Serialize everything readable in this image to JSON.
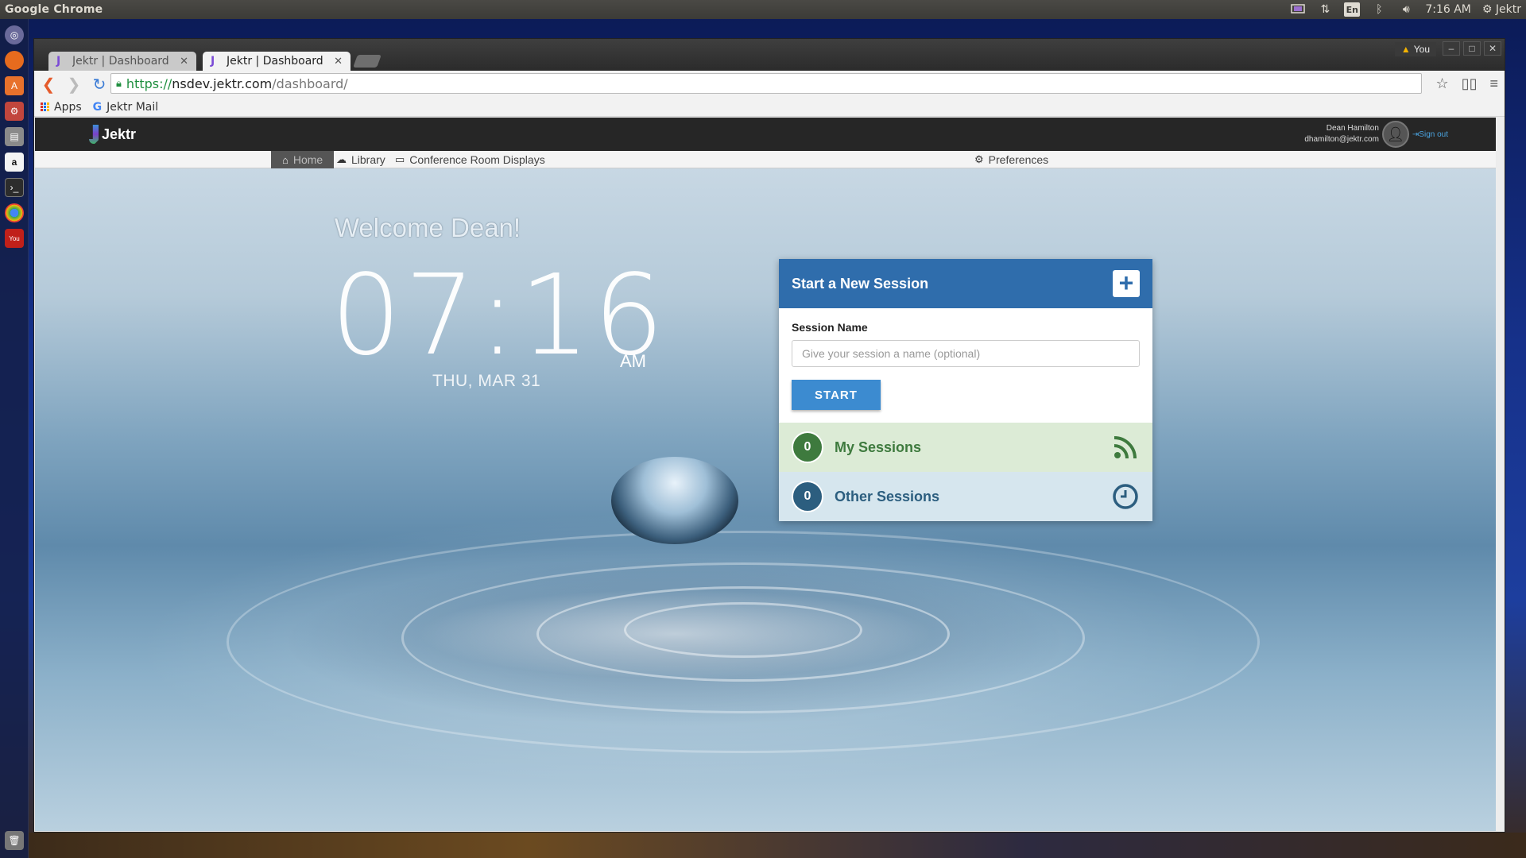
{
  "os_panel": {
    "app_title": "Google Chrome",
    "language": "En",
    "time": "7:16 AM",
    "user": "Jektr"
  },
  "browser": {
    "tabs": [
      {
        "label": "Jektr | Dashboard"
      },
      {
        "label": "Jektr | Dashboard"
      }
    ],
    "profile": "You",
    "url": {
      "scheme": "https://",
      "host": "nsdev.jektr.com",
      "path": "/dashboard/"
    },
    "bookmarks": {
      "apps": "Apps",
      "jektr_mail": "Jektr Mail"
    }
  },
  "app": {
    "brand": "Jektr",
    "user_name": "Dean Hamilton",
    "user_email": "dhamilton@jektr.com",
    "sign_out": "Sign out",
    "nav": {
      "home": "Home",
      "library": "Library",
      "displays": "Conference Room Displays",
      "preferences": "Preferences"
    }
  },
  "dashboard": {
    "welcome": "Welcome Dean!",
    "time": "07:16",
    "ampm": "AM",
    "date": "THU, MAR 31"
  },
  "session_card": {
    "title": "Start a New Session",
    "field_label": "Session Name",
    "placeholder": "Give your session a name (optional)",
    "start_label": "START",
    "my_sessions": {
      "count": "0",
      "label": "My Sessions"
    },
    "other_sessions": {
      "count": "0",
      "label": "Other Sessions"
    }
  },
  "colors": {
    "header_blue": "#2f6dac",
    "start_blue": "#3c8bd0",
    "my_green": "#3e7a3e",
    "other_blue": "#2c5e7f"
  }
}
